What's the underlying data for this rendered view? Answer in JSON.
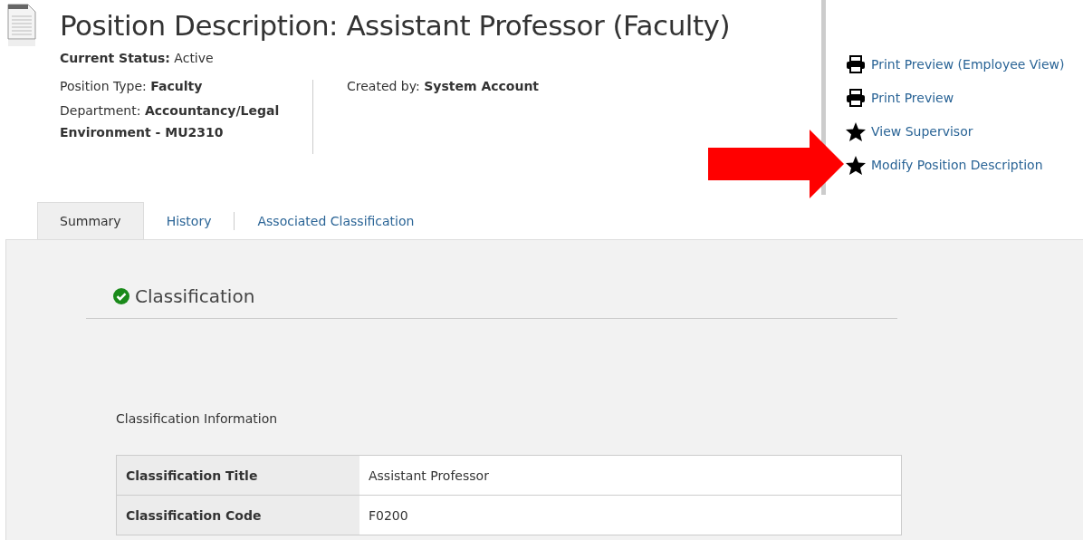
{
  "header": {
    "title": "Position Description: Assistant Professor (Faculty)",
    "status": "**Current Status:** Active",
    "details_left": [
      "Position Type: **Faculty**",
      "Department: **Accountancy/Legal Environment - MU2310**"
    ],
    "details_right": [
      "Created by: **System Account**"
    ]
  },
  "actions": [
    {
      "kind": "print",
      "label": "Print Preview (Employee View)"
    },
    {
      "kind": "print",
      "label": "Print Preview"
    },
    {
      "kind": "star",
      "label": "View Supervisor"
    },
    {
      "kind": "star",
      "label": "Modify Position Description"
    }
  ],
  "tabs": [
    {
      "label": "Summary",
      "selected": true
    },
    {
      "label": "History",
      "selected": false
    },
    {
      "label": "Associated Classification",
      "selected": false
    }
  ],
  "section": {
    "title": "Classification",
    "complete": true,
    "subtitle": "Classification Information",
    "rows": [
      {
        "label": "Classification Title",
        "value": "Assistant Professor"
      },
      {
        "label": "Classification Code",
        "value": "F0200"
      }
    ]
  }
}
